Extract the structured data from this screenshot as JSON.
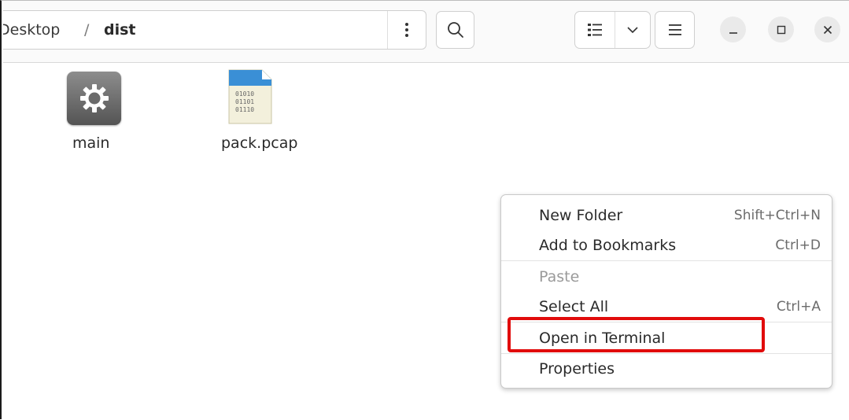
{
  "breadcrumb": {
    "segments": [
      "Desktop",
      "dist"
    ],
    "separator": "/"
  },
  "header": {
    "path_menu_icon": "vertical-dots-icon",
    "search_icon": "search-icon",
    "view_list_icon": "list-view-icon",
    "view_options_icon": "chevron-down-icon",
    "main_menu_icon": "hamburger-icon",
    "window_controls": [
      "minimize-icon",
      "maximize-icon",
      "close-icon"
    ]
  },
  "files": [
    {
      "name": "main",
      "icon": "executable-gear-icon"
    },
    {
      "name": "pack.pcap",
      "icon": "binary-file-icon",
      "icon_text": [
        "01010",
        "01101",
        "01110"
      ]
    }
  ],
  "context_menu": {
    "items": [
      {
        "label": "New Folder",
        "shortcut": "Shift+Ctrl+N",
        "enabled": true
      },
      {
        "label": "Add to Bookmarks",
        "shortcut": "Ctrl+D",
        "enabled": true
      },
      {
        "label": "Paste",
        "shortcut": "",
        "enabled": false
      },
      {
        "label": "Select All",
        "shortcut": "Ctrl+A",
        "enabled": true
      },
      {
        "label": "Open in Terminal",
        "shortcut": "",
        "enabled": true,
        "highlighted": true
      },
      {
        "label": "Properties",
        "shortcut": "",
        "enabled": true
      }
    ]
  },
  "colors": {
    "highlight": "#e10b0b",
    "accent_blue": "#3584e4"
  }
}
